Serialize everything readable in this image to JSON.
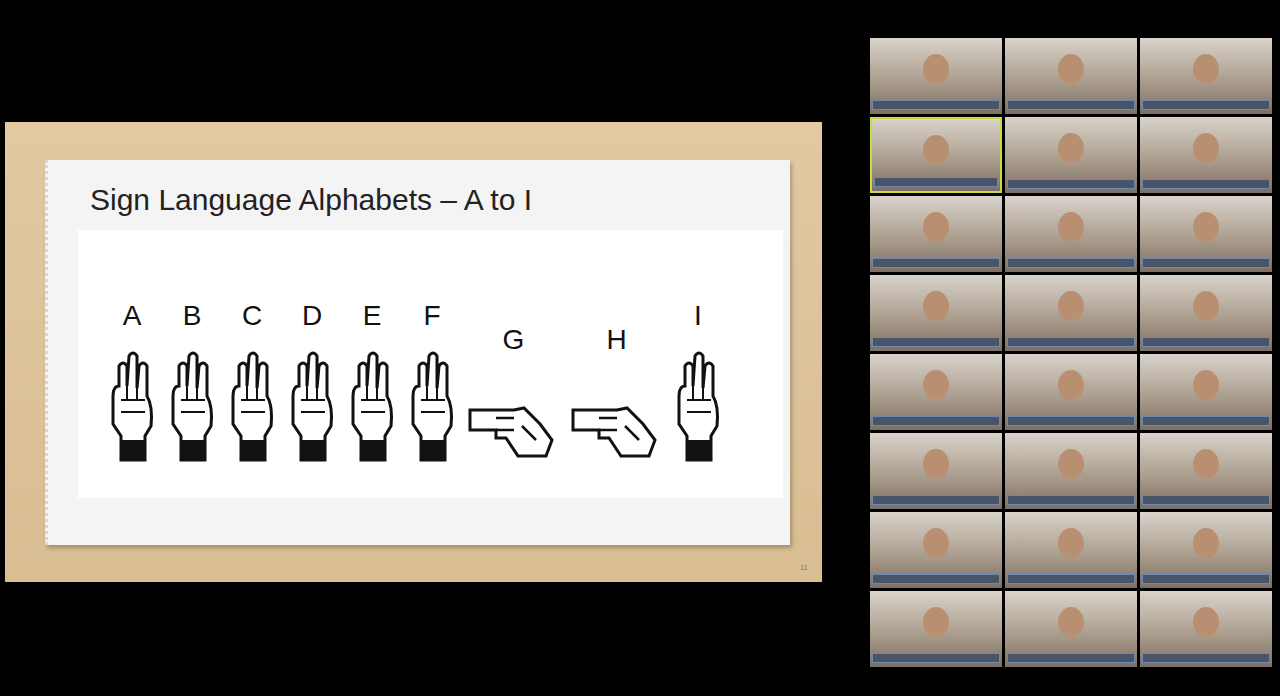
{
  "slide": {
    "title": "Sign Language Alphabets – A to I",
    "page": "11",
    "letters": [
      {
        "label": "A",
        "kind": "upright"
      },
      {
        "label": "B",
        "kind": "upright"
      },
      {
        "label": "C",
        "kind": "upright"
      },
      {
        "label": "D",
        "kind": "upright"
      },
      {
        "label": "E",
        "kind": "upright"
      },
      {
        "label": "F",
        "kind": "upright"
      },
      {
        "label": "G",
        "kind": "sideways"
      },
      {
        "label": "H",
        "kind": "sideways"
      },
      {
        "label": "I",
        "kind": "upright"
      }
    ]
  },
  "gallery": {
    "participants": [
      {
        "speaking": false
      },
      {
        "speaking": false
      },
      {
        "speaking": false
      },
      {
        "speaking": true
      },
      {
        "speaking": false
      },
      {
        "speaking": false
      },
      {
        "speaking": false
      },
      {
        "speaking": false
      },
      {
        "speaking": false
      },
      {
        "speaking": false
      },
      {
        "speaking": false
      },
      {
        "speaking": false
      },
      {
        "speaking": false
      },
      {
        "speaking": false
      },
      {
        "speaking": false
      },
      {
        "speaking": false
      },
      {
        "speaking": false
      },
      {
        "speaking": false
      },
      {
        "speaking": false
      },
      {
        "speaking": false
      },
      {
        "speaking": false
      },
      {
        "speaking": false
      },
      {
        "speaking": false
      },
      {
        "speaking": false
      }
    ]
  }
}
